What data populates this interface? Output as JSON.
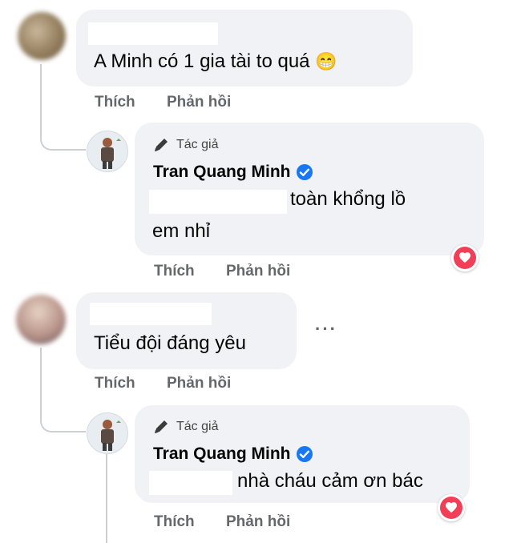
{
  "comments": [
    {
      "text": "A Minh có 1 gia tài to quá",
      "emoji": "😁",
      "actions": {
        "like": "Thích",
        "reply": "Phản hồi"
      },
      "reply": {
        "author_tag": "Tác giả",
        "name": "Tran Quang Minh",
        "line1": "toàn khổng lồ",
        "line2": "em nhỉ",
        "actions": {
          "like": "Thích",
          "reply": "Phản hồi"
        }
      }
    },
    {
      "text": "Tiểu đội đáng yêu",
      "more": "···",
      "actions": {
        "like": "Thích",
        "reply": "Phản hồi"
      },
      "reply": {
        "author_tag": "Tác giả",
        "name": "Tran Quang Minh",
        "line1": "nhà cháu cảm ơn bác",
        "actions": {
          "like": "Thích",
          "reply": "Phản hồi"
        }
      }
    }
  ],
  "colors": {
    "bubble": "#f0f2f5",
    "verified": "#1877f2",
    "heart": "#f33e58",
    "action_text": "#65676b"
  },
  "icons": [
    "pen-icon",
    "verified-icon",
    "heart-reaction-icon",
    "grin-emoji-icon",
    "more-options-icon"
  ]
}
